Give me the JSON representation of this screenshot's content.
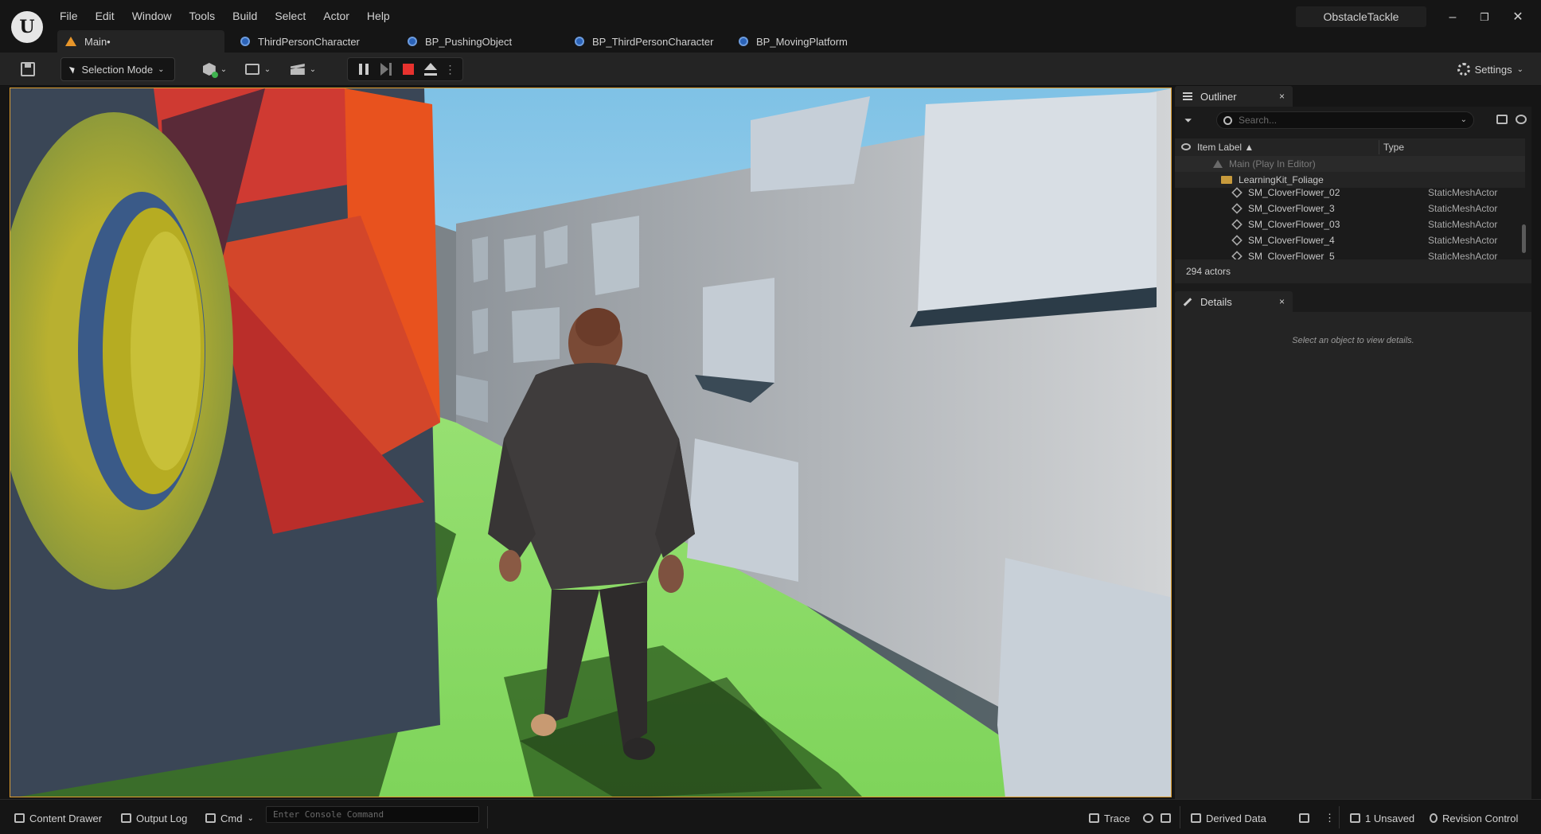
{
  "app": {
    "logo_text": "U",
    "menu": [
      "File",
      "Edit",
      "Window",
      "Tools",
      "Build",
      "Select",
      "Actor",
      "Help"
    ],
    "project_name": "ObstacleTackle",
    "window_controls": {
      "minimize": "–",
      "restore": "❐",
      "close": "✕"
    }
  },
  "tabs": [
    {
      "label": "Main•",
      "icon": "level-icon",
      "active": true
    },
    {
      "label": "ThirdPersonCharacter",
      "icon": "blueprint-icon"
    },
    {
      "label": "BP_PushingObject",
      "icon": "blueprint-icon"
    },
    {
      "label": "BP_ThirdPersonCharacter",
      "icon": "blueprint-icon"
    },
    {
      "label": "BP_MovingPlatform",
      "icon": "blueprint-icon"
    }
  ],
  "toolbar": {
    "selection_mode": "Selection Mode",
    "settings": "Settings",
    "chevron": "⌄",
    "more": "⋮"
  },
  "outliner": {
    "tab_title": "Outliner",
    "close": "×",
    "filter": "⏷",
    "search_placeholder": "Search...",
    "col_label": "Item Label ▲",
    "col_type": "Type",
    "rows": [
      {
        "label": "Main (Play In Editor)",
        "type": "",
        "kind": "level"
      },
      {
        "label": "LearningKit_Foliage",
        "type": "",
        "kind": "folder"
      },
      {
        "label": "SM_CloverFlower_02",
        "type": "StaticMeshActor",
        "kind": "mesh"
      },
      {
        "label": "SM_CloverFlower_3",
        "type": "StaticMeshActor",
        "kind": "mesh"
      },
      {
        "label": "SM_CloverFlower_03",
        "type": "StaticMeshActor",
        "kind": "mesh"
      },
      {
        "label": "SM_CloverFlower_4",
        "type": "StaticMeshActor",
        "kind": "mesh"
      },
      {
        "label": "SM_CloverFlower_5",
        "type": "StaticMeshActor",
        "kind": "mesh"
      }
    ],
    "actor_count": "294 actors"
  },
  "details": {
    "tab_title": "Details",
    "close": "×",
    "empty_message": "Select an object to view details."
  },
  "statusbar": {
    "content_drawer": "Content Drawer",
    "output_log": "Output Log",
    "cmd": "Cmd",
    "console_placeholder": "Enter Console Command",
    "trace": "Trace",
    "derived_data": "Derived Data",
    "unsaved": "1 Unsaved",
    "revision_control": "Revision Control"
  }
}
